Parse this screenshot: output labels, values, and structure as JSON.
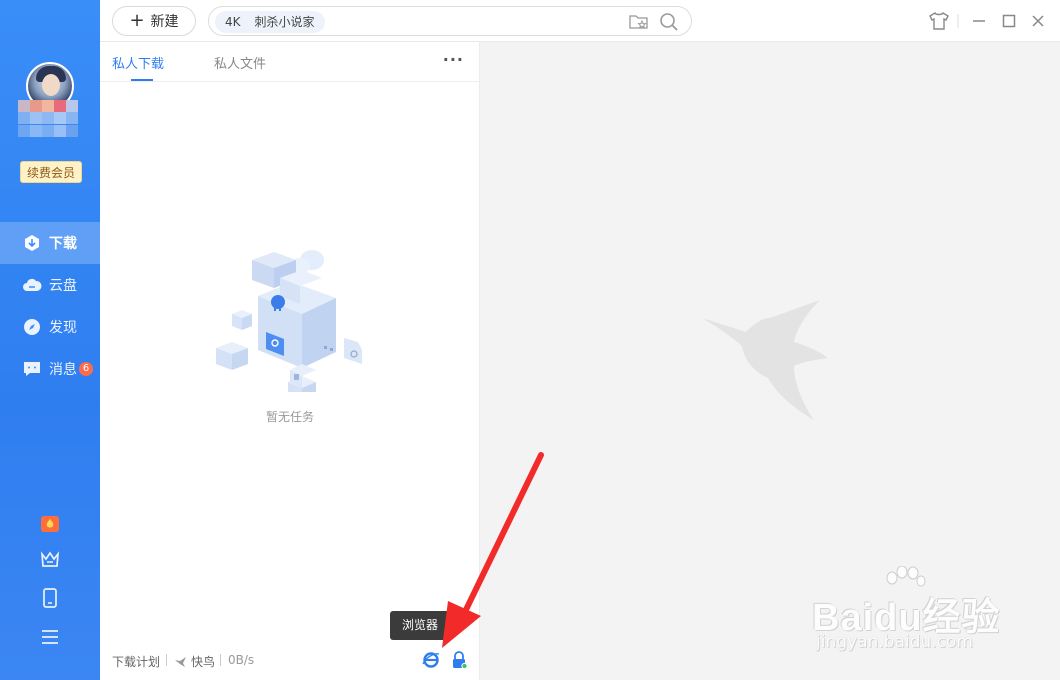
{
  "sidebar": {
    "renew_label": "续费会员",
    "nav": [
      {
        "label": "下载",
        "icon": "download-icon",
        "active": true
      },
      {
        "label": "云盘",
        "icon": "cloud-icon"
      },
      {
        "label": "发现",
        "icon": "compass-icon"
      },
      {
        "label": "消息",
        "icon": "message-icon",
        "badge": "6"
      }
    ],
    "bottom_icons": [
      "gift-icon",
      "crown-icon",
      "phone-icon",
      "menu-icon"
    ]
  },
  "toolbar": {
    "new_label": "新建",
    "search_chip_prefix": "4K",
    "search_chip_text": "刺杀小说家"
  },
  "panel": {
    "tabs": [
      {
        "label": "私人下载",
        "active": true
      },
      {
        "label": "私人文件"
      }
    ],
    "more_label": "···",
    "empty_text": "暂无任务",
    "status": {
      "plan_label": "下载计划",
      "kuainiao_label": "快鸟",
      "speed": "0B/s"
    },
    "tooltip_text": "浏览器"
  },
  "colors": {
    "accent": "#2f7ef0",
    "sidebar": "#3a8ef8",
    "badge": "#ff6b4a"
  },
  "watermark": {
    "main": "Baidu经验",
    "sub": "jingyan.baidu.com"
  }
}
